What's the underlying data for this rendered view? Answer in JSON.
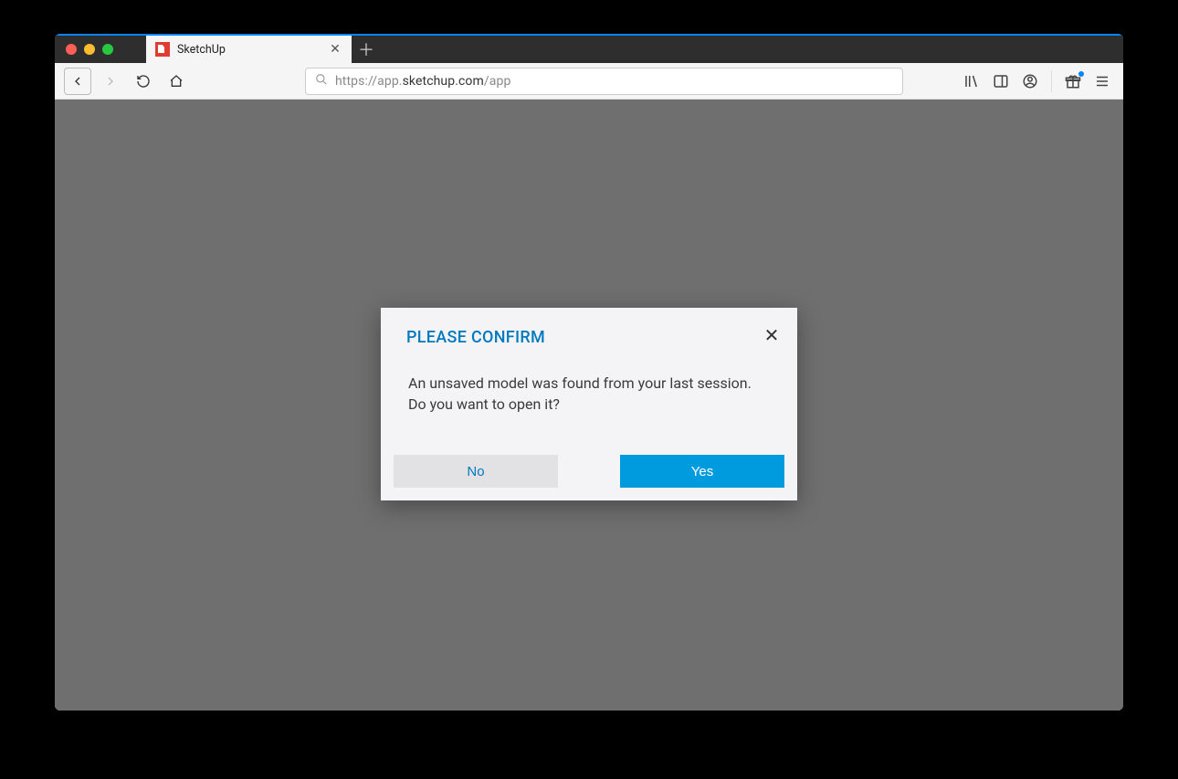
{
  "browser": {
    "tab": {
      "title": "SketchUp"
    },
    "url": {
      "pre": "https://app.",
      "bold": "sketchup.com",
      "post": "/app"
    }
  },
  "modal": {
    "title": "PLEASE CONFIRM",
    "line1": "An unsaved model was found from your last session.",
    "line2": "Do you want to open it?",
    "no": "No",
    "yes": "Yes"
  }
}
